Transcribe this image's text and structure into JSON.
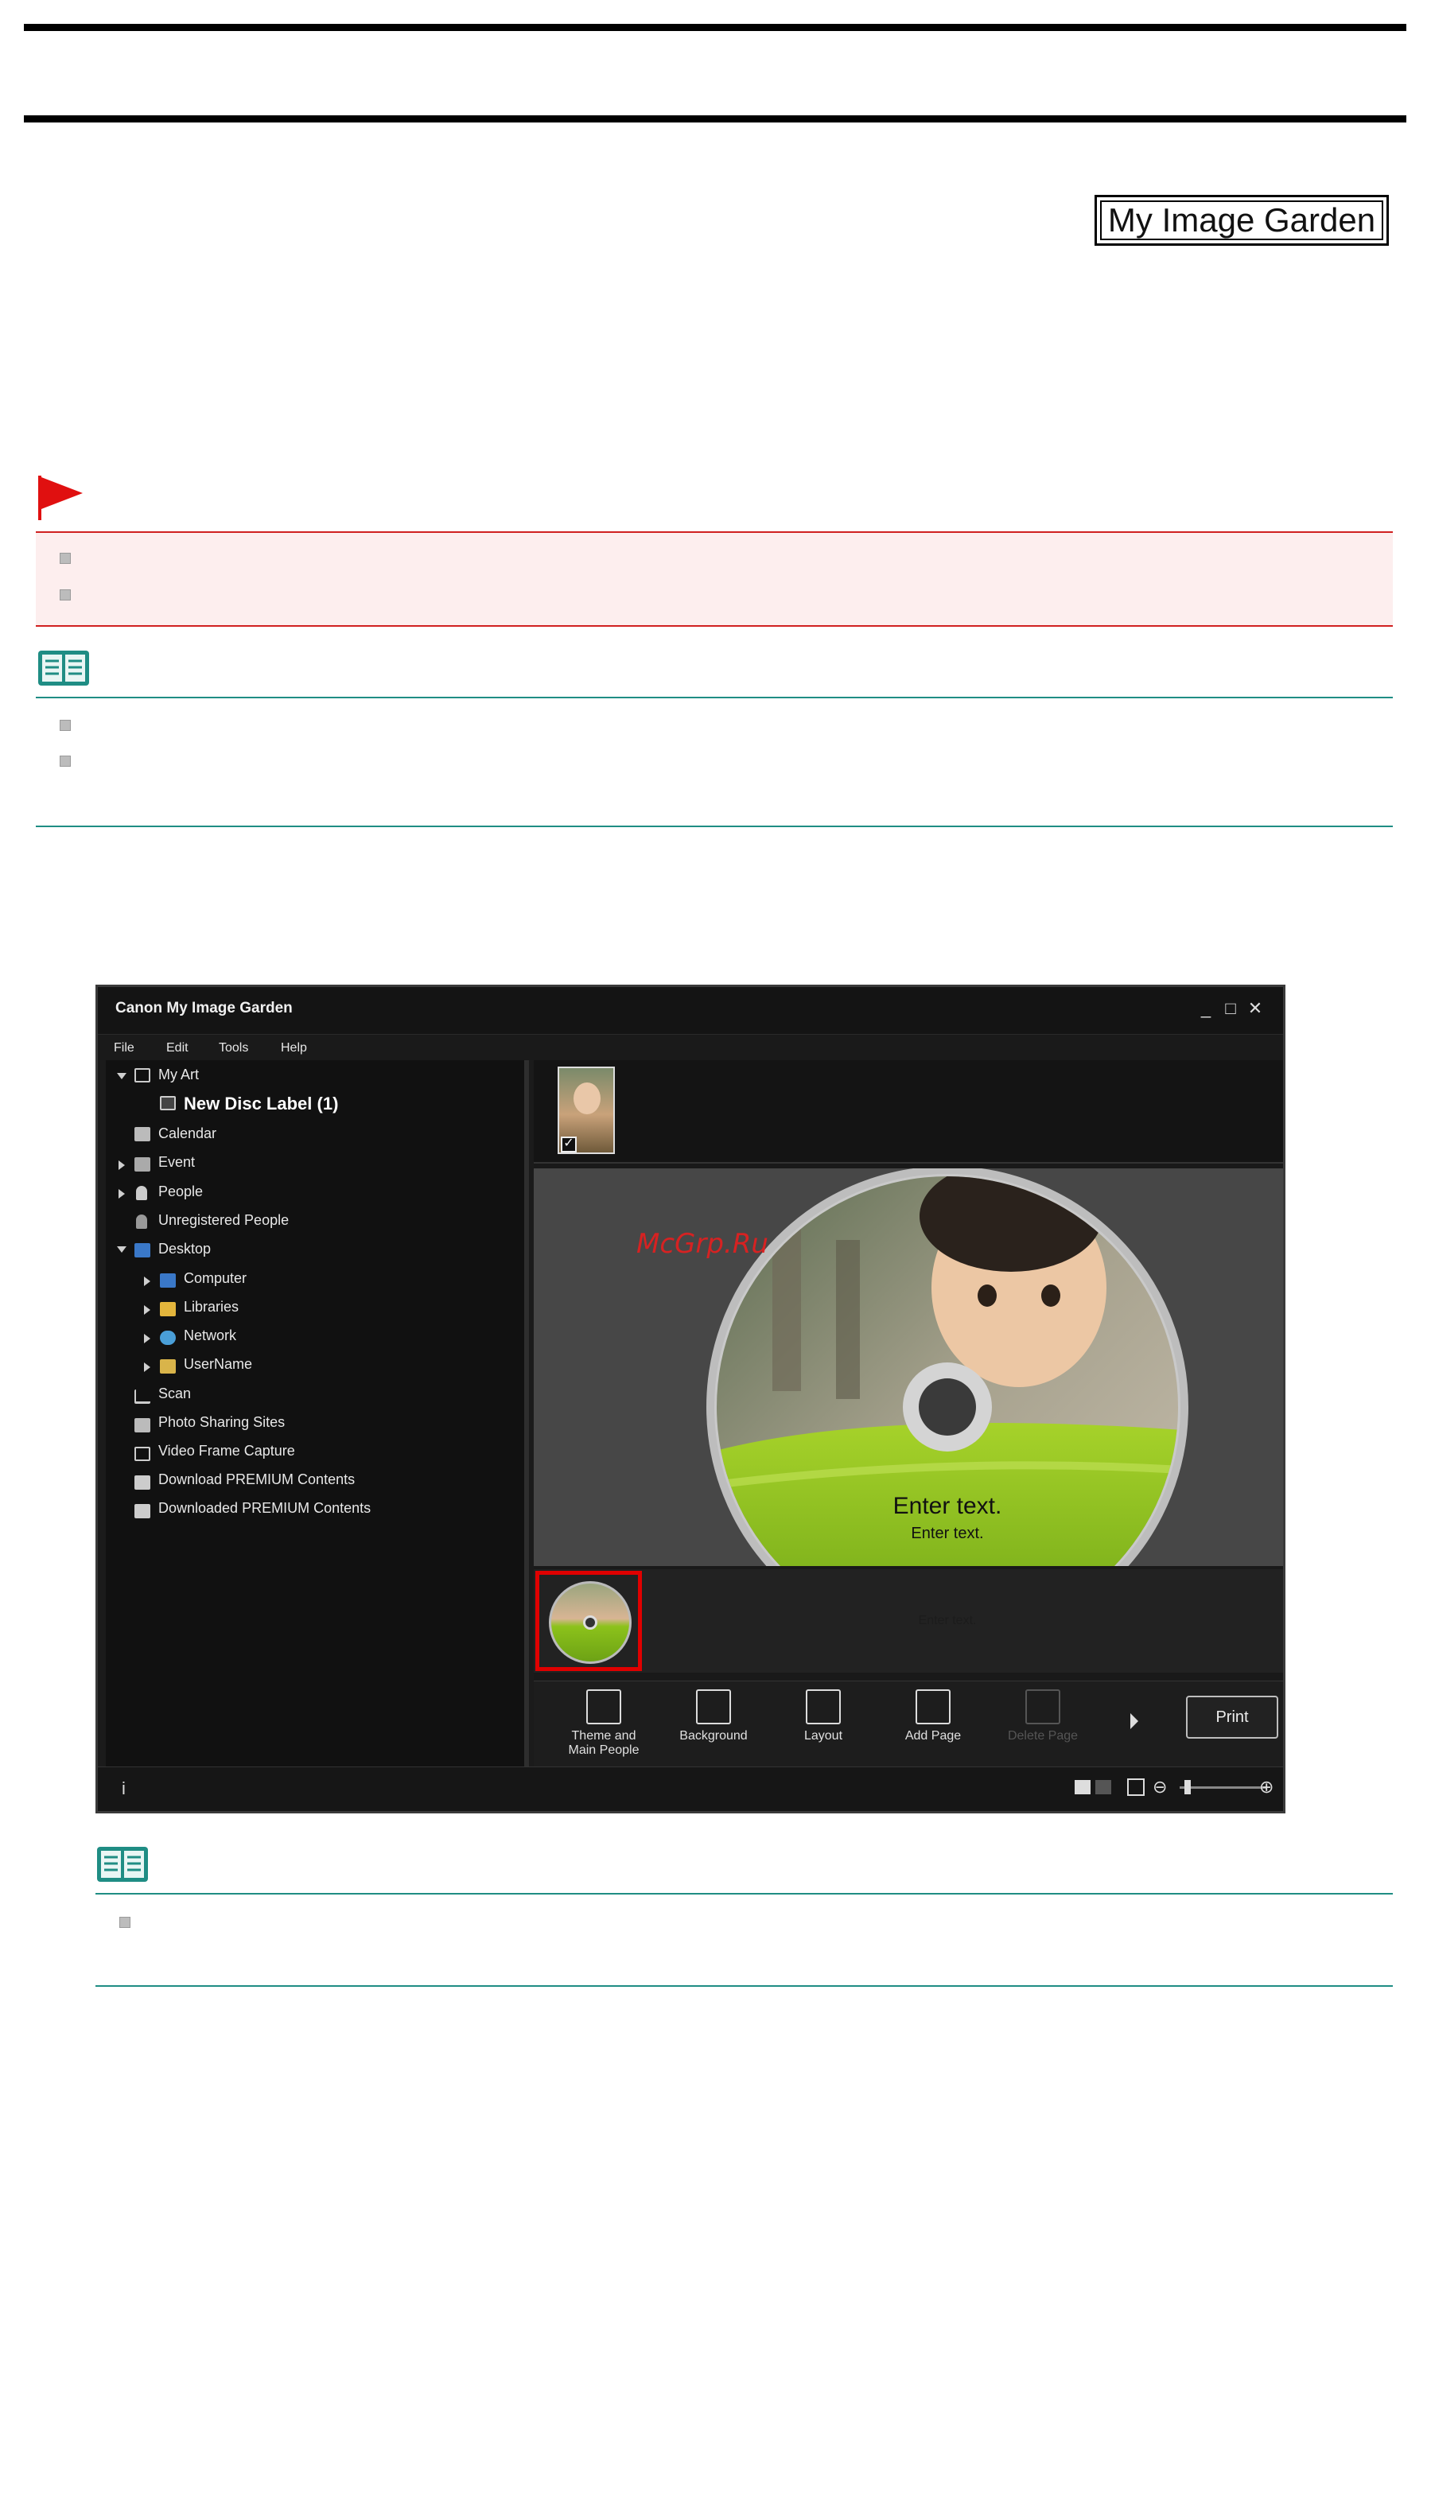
{
  "badge": {
    "text": "My Image Garden"
  },
  "app": {
    "title": "Canon My Image Garden",
    "menu": [
      "File",
      "Edit",
      "Tools",
      "Help"
    ],
    "tree": [
      {
        "label": "My Art",
        "arrow": "down",
        "bold": false
      },
      {
        "label": "New Disc Label (1)",
        "arrow": "",
        "bold": true
      },
      {
        "label": "Calendar",
        "arrow": "",
        "bold": false
      },
      {
        "label": "Event",
        "arrow": "right",
        "bold": false
      },
      {
        "label": "People",
        "arrow": "right",
        "bold": false
      },
      {
        "label": "Unregistered People",
        "arrow": "",
        "bold": false
      },
      {
        "label": "Desktop",
        "arrow": "down",
        "bold": false
      },
      {
        "label": "Computer",
        "arrow": "right",
        "bold": false
      },
      {
        "label": "Libraries",
        "arrow": "right",
        "bold": false
      },
      {
        "label": "Network",
        "arrow": "right",
        "bold": false
      },
      {
        "label": "UserName",
        "arrow": "right",
        "bold": false
      },
      {
        "label": "Scan",
        "arrow": "",
        "bold": false
      },
      {
        "label": "Photo Sharing Sites",
        "arrow": "",
        "bold": false
      },
      {
        "label": "Video Frame Capture",
        "arrow": "",
        "bold": false
      },
      {
        "label": "Download PREMIUM Contents",
        "arrow": "",
        "bold": false
      },
      {
        "label": "Downloaded PREMIUM Contents",
        "arrow": "",
        "bold": false
      }
    ],
    "disc": {
      "text_large": "Enter text.",
      "text_small": "Enter text.",
      "text_lower": "Enter text."
    },
    "toolbar": {
      "theme_line1": "Theme and",
      "theme_line2": "Main People",
      "background": "Background",
      "layout": "Layout",
      "add_page": "Add Page",
      "delete_page": "Delete Page",
      "print": "Print"
    },
    "status": {
      "info": "i"
    }
  },
  "watermark": "McGrp.Ru",
  "colors": {
    "important_red": "#d02020",
    "note_teal": "#1f8d84",
    "selection_red": "#e00000",
    "disc_green": "#8cc21b"
  }
}
